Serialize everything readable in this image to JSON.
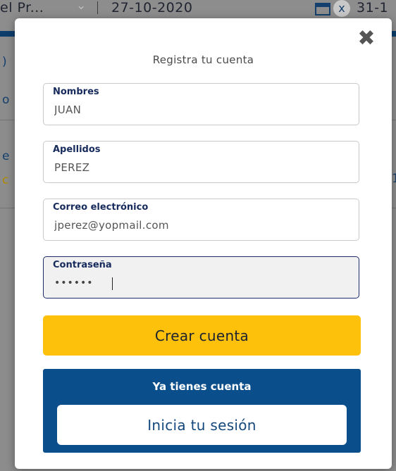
{
  "background": {
    "filter_text": "el Pr...",
    "date_from": "27-10-2020",
    "date_to_partial": "31-1"
  },
  "modal": {
    "title": "Registra tu cuenta",
    "close_icon": "close-icon",
    "fields": [
      {
        "label": "Nombres",
        "value": "JUAN"
      },
      {
        "label": "Apellidos",
        "value": "PEREZ"
      },
      {
        "label": "Correo electrónico",
        "value": "jperez@yopmail.com"
      },
      {
        "label": "Contraseña",
        "value": "••••••"
      }
    ],
    "create_button": "Crear cuenta",
    "login_prompt": "Ya tienes cuenta",
    "login_button": "Inicia tu sesión"
  },
  "colors": {
    "accent_yellow": "#fdc10b",
    "brand_blue": "#0a4f8b",
    "label_navy": "#162a5c"
  }
}
